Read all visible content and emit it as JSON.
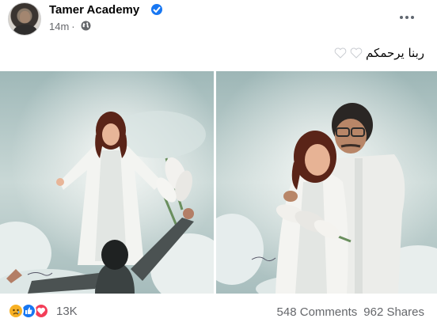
{
  "post": {
    "page_name": "Tamer Academy",
    "time": "14m",
    "privacy_icon": "globe-icon",
    "caption": "ربنا يرحمكم",
    "caption_emoji": "white-heart",
    "reactions": [
      "sad",
      "like",
      "love"
    ],
    "reaction_count": "13K",
    "comments": "548 Comments",
    "shares": "962 Shares"
  },
  "colors": {
    "verified_badge": "#1877f2",
    "meta_text": "#65676b",
    "sky": "#a9bfc0",
    "gown": "#f4f4f2",
    "hair": "#5a2418"
  }
}
